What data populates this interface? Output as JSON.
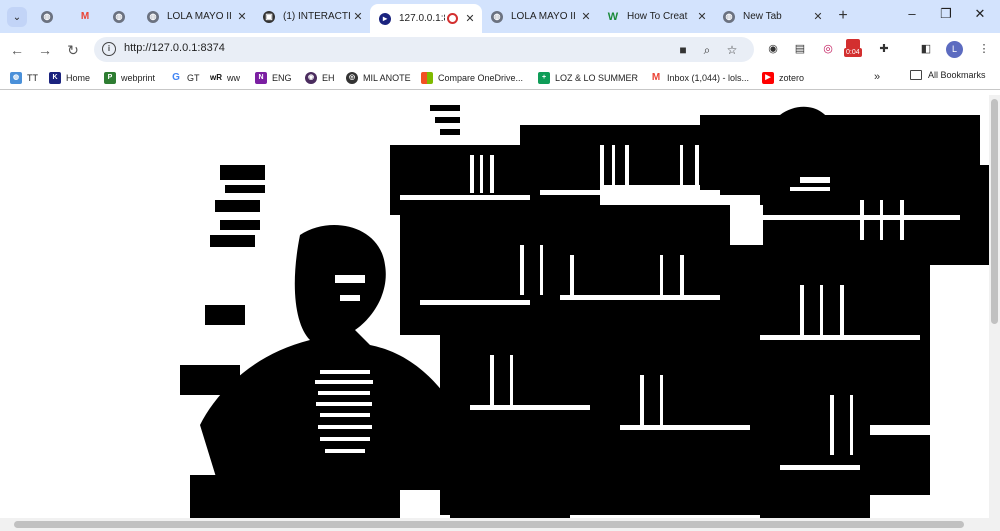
{
  "tabs": [
    {
      "title": "",
      "favicon": "globe",
      "closable": true
    },
    {
      "title": "",
      "favicon": "gmail",
      "closable": false
    },
    {
      "title": "",
      "favicon": "globe",
      "closable": false
    },
    {
      "title": "LOLA MAYO II",
      "favicon": "globe",
      "closable": true
    },
    {
      "title": "(1) INTERACTI",
      "favicon": "shield",
      "closable": true
    },
    {
      "title": "127.0.0.1:8",
      "favicon": "p5",
      "closable": true,
      "active": true
    },
    {
      "title": "LOLA MAYO II",
      "favicon": "globe",
      "closable": true
    },
    {
      "title": "How To Creat",
      "favicon": "wikihow",
      "closable": true
    },
    {
      "title": "New Tab",
      "favicon": "chrome",
      "closable": true
    }
  ],
  "window": {
    "minimize": "–",
    "restore": "❐",
    "close": "✕"
  },
  "omnibox": {
    "url": "http://127.0.0.1:8374"
  },
  "timer_badge": "0:04",
  "avatar_letter": "L",
  "bookmarks": [
    {
      "label": "TT",
      "icon": "tt"
    },
    {
      "label": "Home",
      "icon": "home"
    },
    {
      "label": "webprint",
      "icon": "webprint"
    },
    {
      "label": "GT",
      "icon": "google"
    },
    {
      "label": "ww",
      "icon": "wr"
    },
    {
      "label": "ENG",
      "icon": "onenote"
    },
    {
      "label": "EH",
      "icon": "eh"
    },
    {
      "label": "MIL ANOTE",
      "icon": "mil"
    },
    {
      "label": "Compare OneDrive...",
      "icon": "microsoft"
    },
    {
      "label": "LOZ & LO SUMMER",
      "icon": "sheets"
    },
    {
      "label": "Inbox (1,044) - lols...",
      "icon": "gmail"
    },
    {
      "label": "zotero",
      "icon": "youtube"
    }
  ],
  "all_bookmarks": "All Bookmarks"
}
